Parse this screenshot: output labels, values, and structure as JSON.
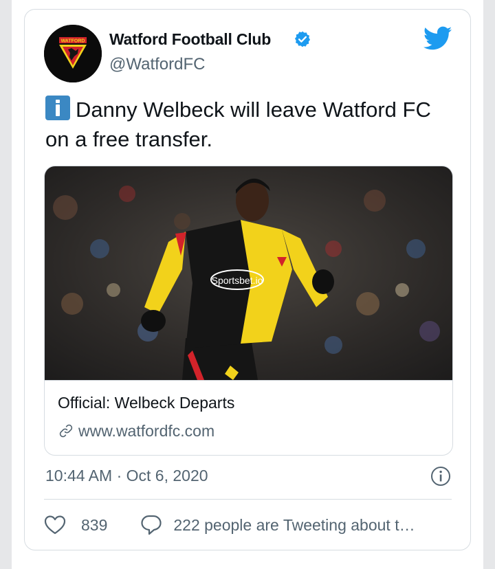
{
  "tweet": {
    "author_name": "Watford Football Club",
    "author_handle": "@WatfordFC",
    "avatar_badge_text": "WATFORD",
    "text": "Danny Welbeck will leave Watford FC on a free transfer.",
    "leading_emoji": "information-emoji",
    "card": {
      "title": "Official: Welbeck Departs",
      "domain": "www.watfordfc.com",
      "shirt_sponsor": "Sportsbet.io"
    },
    "timestamp": "10:44 AM · Oct 6, 2020",
    "like_count": "839",
    "conversation_text": "222 people are Tweeting about t…"
  },
  "icons": {
    "verified": "verified-badge-icon",
    "platform": "twitter-bird-icon",
    "link": "link-icon",
    "info": "info-icon",
    "like": "heart-icon",
    "reply": "reply-bubble-icon"
  },
  "colors": {
    "twitter_blue": "#1d9bf0",
    "text_primary": "#0f1419",
    "text_secondary": "#536471",
    "border": "#d6dce1",
    "kit_yellow": "#f2d21b",
    "kit_black": "#151515",
    "kit_red": "#d2232a"
  }
}
